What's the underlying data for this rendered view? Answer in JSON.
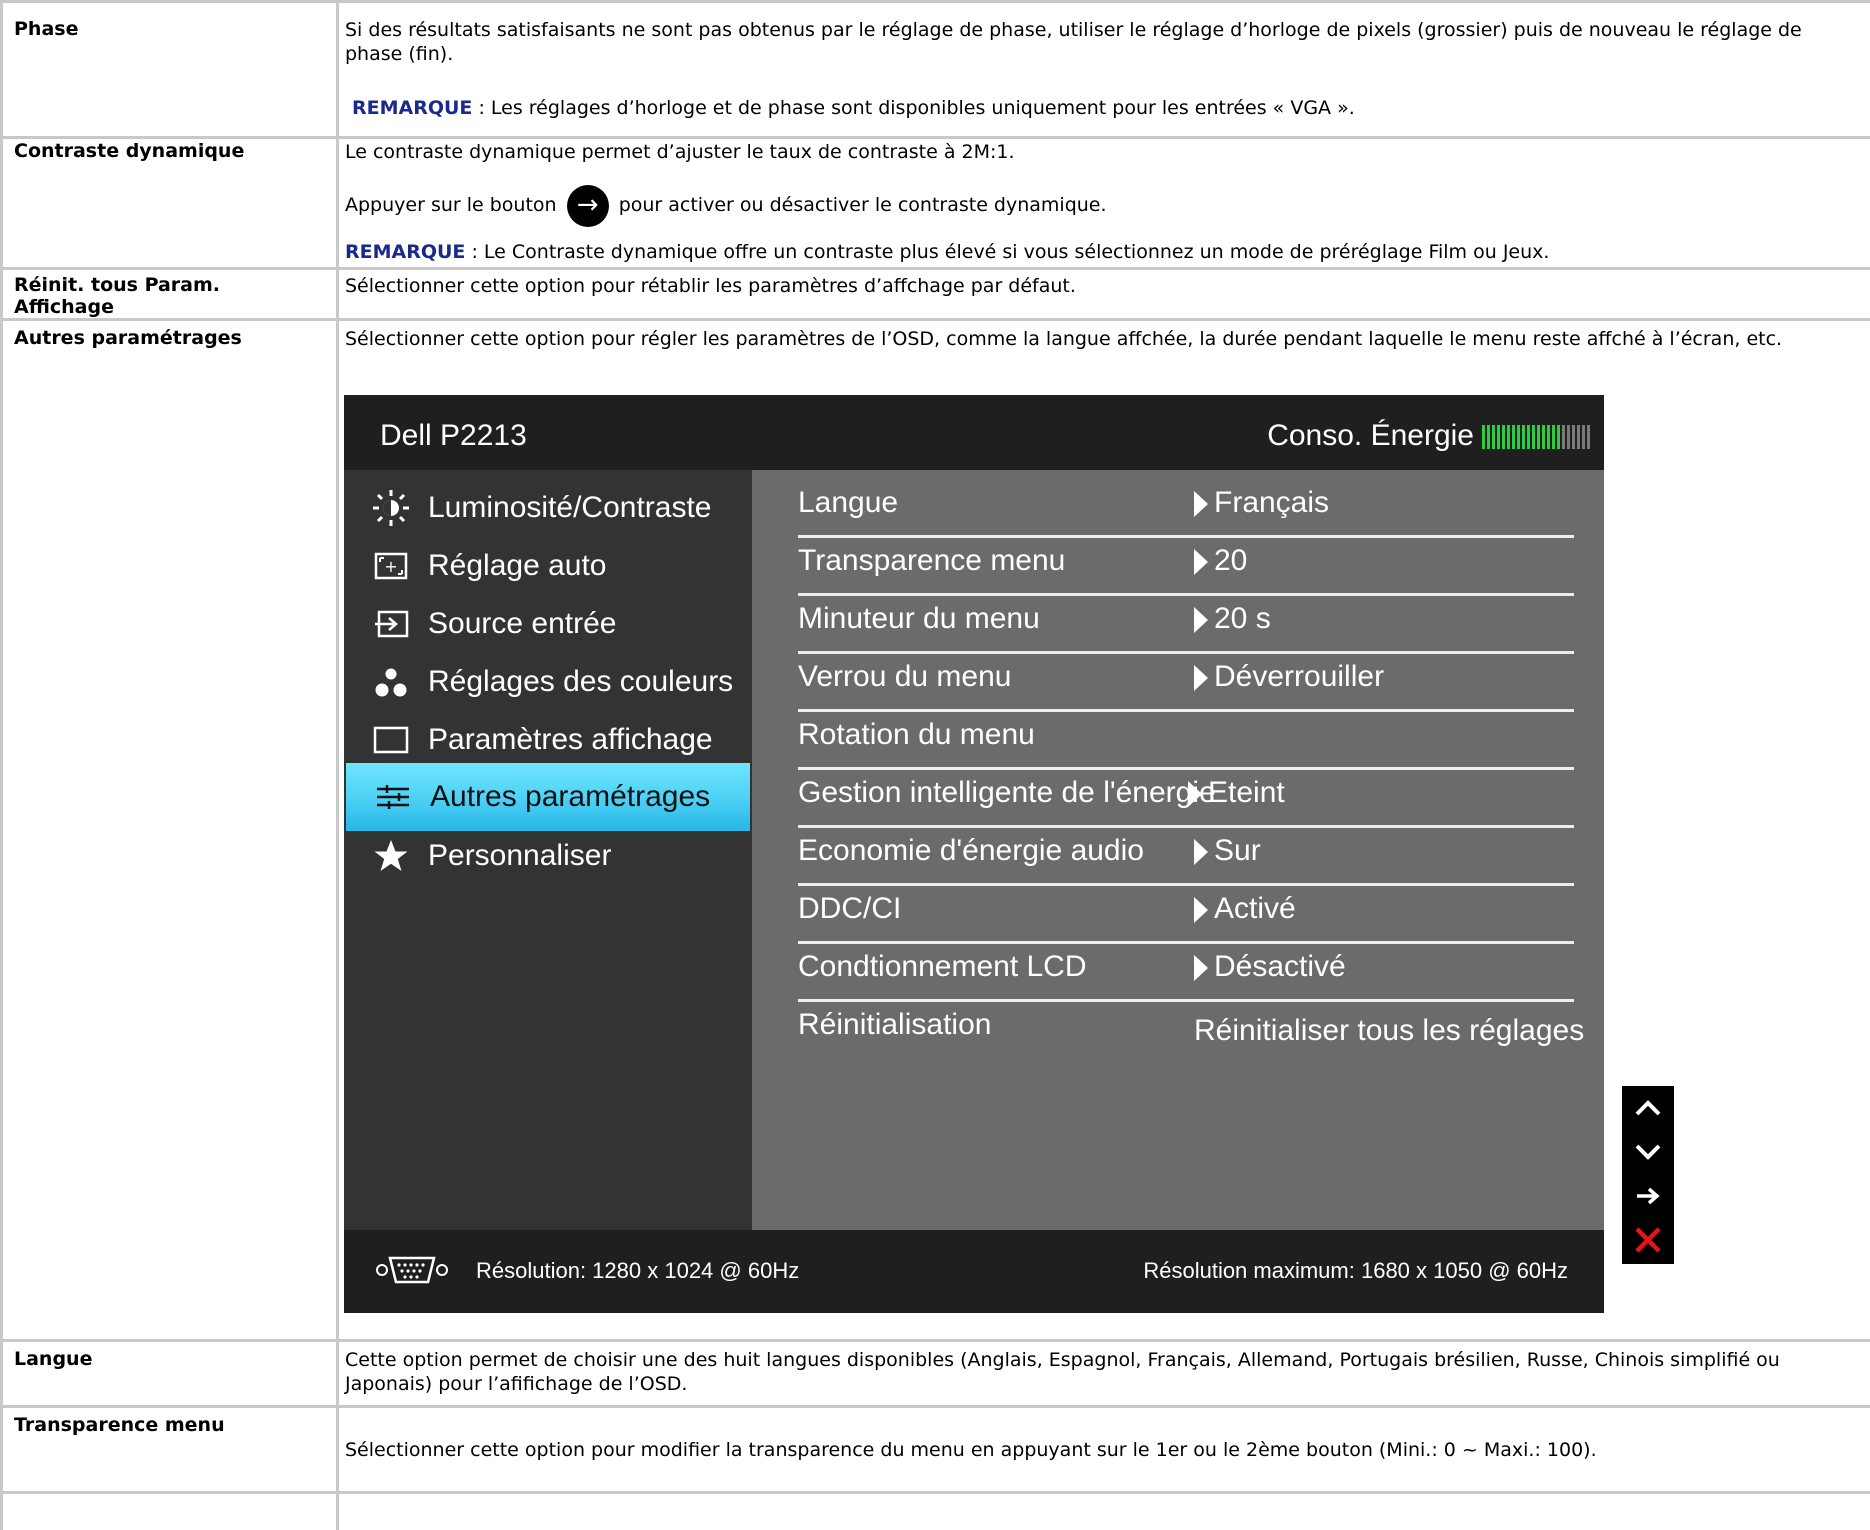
{
  "rows": [
    {
      "label": "Phase",
      "text": "Si des résultats satisfaisants ne sont pas obtenus par le réglage de phase, utiliser le réglage d’horloge de pixels (grossier) puis de nouveau le réglage de phase (fin).",
      "note_label": "REMARQUE",
      "note_text": " : Les réglages d’horloge et de phase sont disponibles uniquement pour les entrées « VGA »."
    },
    {
      "label": "Contraste dynamique",
      "text1": "Le contraste dynamique permet d’ajuster le taux de contraste à 2M:1.",
      "text2_pre": "Appuyer sur le bouton",
      "text2_post": "pour activer ou désactiver le contraste dynamique.",
      "note_label": "REMARQUE",
      "note_text": " : Le Contraste dynamique offre un contraste plus élevé si vous sélectionnez un mode de préréglage Film ou Jeux."
    },
    {
      "label": "Réinit. tous Param. Affichage",
      "text": "Sélectionner cette option pour rétablir les paramètres d’affchage par défaut."
    },
    {
      "label": "Autres paramétrages",
      "text": "Sélectionner cette option pour régler les paramètres de l’OSD, comme la langue affchée, la durée pendant laquelle le menu reste affché à l’écran, etc."
    },
    {
      "label": "Langue",
      "text": "Cette option permet de choisir une des huit langues disponibles (Anglais, Espagnol, Français, Allemand, Portugais brésilien, Russe, Chinois simplifié ou Japonais) pour l’afifichage de l’OSD."
    },
    {
      "label": "Transparence menu",
      "text": "Sélectionner cette option pour modifier la transparence du menu en appuyant sur le 1er ou le 2ème bouton (Mini.: 0 ~ Maxi.: 100)."
    }
  ],
  "osd": {
    "title": "Dell P2213",
    "power_label": "Conso. Énergie",
    "power_level": 0.72,
    "menu": [
      {
        "label": "Luminosité/Contraste",
        "icon": "brightness-icon"
      },
      {
        "label": "Réglage auto",
        "icon": "auto-adjust-icon"
      },
      {
        "label": "Source entrée",
        "icon": "input-source-icon"
      },
      {
        "label": "Réglages des couleurs",
        "icon": "color-settings-icon"
      },
      {
        "label": "Paramètres affichage",
        "icon": "display-settings-icon"
      },
      {
        "label": "Autres paramétrages",
        "icon": "other-settings-icon",
        "active": true
      },
      {
        "label": "Personnaliser",
        "icon": "star-icon"
      }
    ],
    "options": [
      {
        "name": "Langue",
        "value": "Français",
        "arrow": true
      },
      {
        "name": "Transparence menu",
        "value": "20",
        "arrow": true
      },
      {
        "name": "Minuteur du menu",
        "value": "20 s",
        "arrow": true
      },
      {
        "name": "Verrou du menu",
        "value": "Déverrouiller",
        "arrow": true
      },
      {
        "name": "Rotation du menu",
        "value": "",
        "arrow": false
      },
      {
        "name": "Gestion intelligente de l'énergie",
        "value": "Eteint",
        "arrow": true
      },
      {
        "name": "Economie d'énergie audio",
        "value": "Sur",
        "arrow": true
      },
      {
        "name": "DDC/CI",
        "value": "Activé",
        "arrow": true
      },
      {
        "name": "Condtionnement LCD",
        "value": "Désactivé",
        "arrow": true
      },
      {
        "name": "Réinitialisation",
        "value": "Réinitialiser tous les réglages",
        "arrow": false
      }
    ],
    "resolution": "Résolution: 1280 x 1024 @ 60Hz",
    "max_resolution": "Résolution maximum: 1680 x 1050 @ 60Hz",
    "side_buttons": [
      "up-icon",
      "down-icon",
      "enter-icon",
      "exit-icon"
    ]
  }
}
